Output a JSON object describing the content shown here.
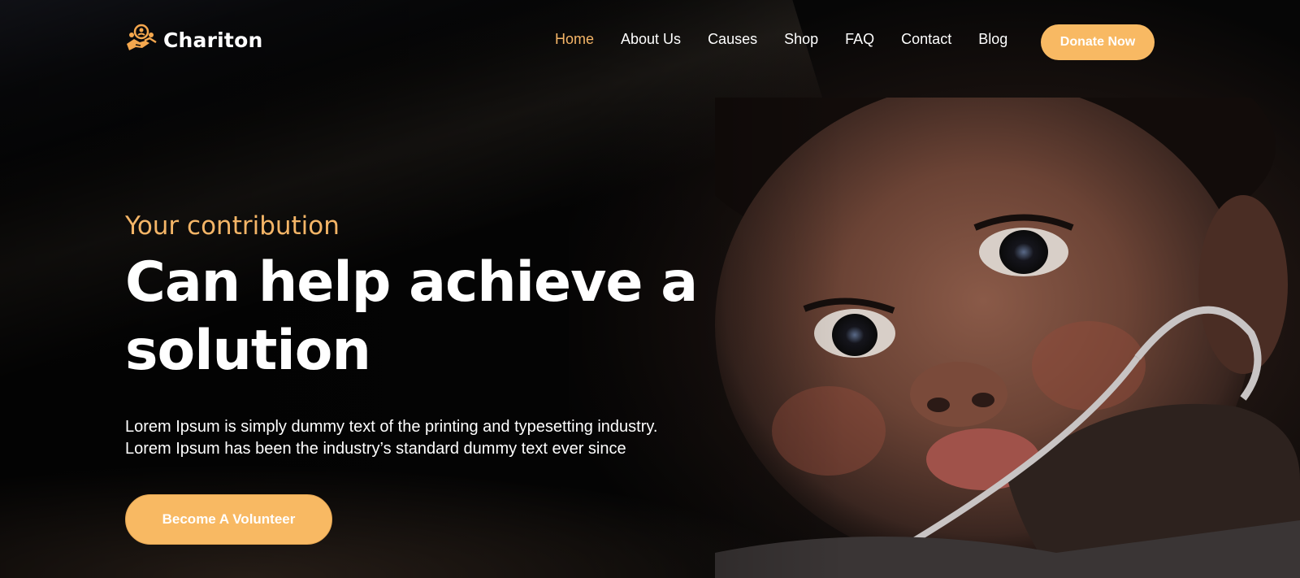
{
  "brand": {
    "name": "Chariton",
    "logo_icon": "charity-hands-icon",
    "accent_color": "#f8b963"
  },
  "nav": {
    "items": [
      {
        "label": "Home",
        "active": true
      },
      {
        "label": "About Us",
        "active": false
      },
      {
        "label": "Causes",
        "active": false
      },
      {
        "label": "Shop",
        "active": false
      },
      {
        "label": "FAQ",
        "active": false
      },
      {
        "label": "Contact",
        "active": false
      },
      {
        "label": "Blog",
        "active": false
      }
    ],
    "donate_label": "Donate Now"
  },
  "hero": {
    "subtitle": "Your contribution",
    "headline_line1": "Can help achieve a",
    "headline_line2": "solution",
    "description_line1": "Lorem Ipsum is simply dummy text of the printing and typesetting industry.",
    "description_line2": "Lorem Ipsum has been the industry’s standard dummy text ever since",
    "cta_label": "Become A Volunteer"
  }
}
